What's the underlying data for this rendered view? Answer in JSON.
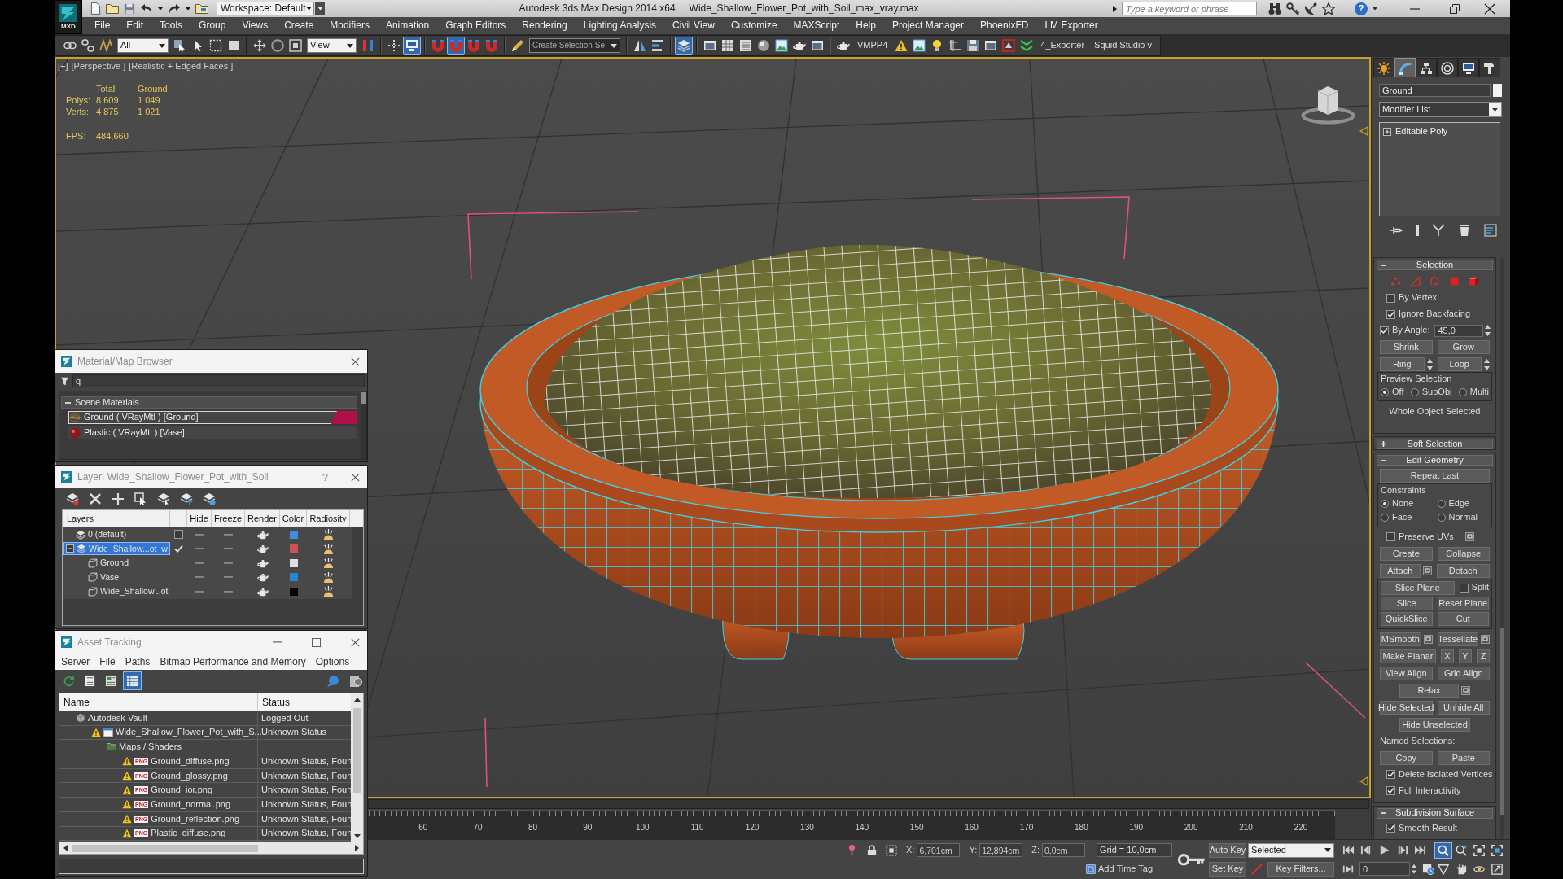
{
  "app": {
    "logo": "MXD",
    "workspace": "Workspace: Default",
    "title": "Autodesk 3ds Max Design 2014 x64",
    "document": "Wide_Shallow_Flower_Pot_with_Soil_max_vray.max",
    "search": {
      "placeholder": "Type a keyword or phrase"
    },
    "help": "?"
  },
  "menu": [
    "File",
    "Edit",
    "Tools",
    "Group",
    "Views",
    "Create",
    "Modifiers",
    "Animation",
    "Graph Editors",
    "Rendering",
    "Lighting Analysis",
    "Civil View",
    "Customize",
    "MAXScript",
    "Help",
    "Project Manager",
    "PhoenixFD",
    "LM Exporter"
  ],
  "toolbar": [
    {
      "kind": "button",
      "on": false
    },
    {
      "kind": "button",
      "on": false
    },
    {
      "kind": "button",
      "on": false
    },
    {
      "kind": "dropdown",
      "value": "All"
    },
    {
      "kind": "button",
      "on": false
    },
    {
      "kind": "button",
      "on": false
    },
    {
      "kind": "button",
      "on": false
    },
    {
      "kind": "button",
      "on": false
    },
    {
      "kind": "separator"
    },
    {
      "kind": "button",
      "on": false
    },
    {
      "kind": "button",
      "on": false
    },
    {
      "kind": "button",
      "on": false
    },
    {
      "kind": "dropdown",
      "value": "View"
    },
    {
      "kind": "button",
      "on": false
    },
    {
      "kind": "separator"
    },
    {
      "kind": "button",
      "on": false
    },
    {
      "kind": "button",
      "on": true
    },
    {
      "kind": "separator"
    },
    {
      "kind": "button",
      "on": false
    },
    {
      "kind": "button",
      "on": true
    },
    {
      "kind": "button",
      "on": false
    },
    {
      "kind": "button",
      "on": false
    },
    {
      "kind": "separator"
    },
    {
      "kind": "button",
      "on": false
    },
    {
      "kind": "combo",
      "value": "Create Selection Se"
    },
    {
      "kind": "separator"
    },
    {
      "kind": "button",
      "on": false
    },
    {
      "kind": "button",
      "on": false
    },
    {
      "kind": "separator"
    },
    {
      "kind": "button",
      "on": true
    },
    {
      "kind": "separator"
    },
    {
      "kind": "button",
      "on": false
    },
    {
      "kind": "button",
      "on": false
    },
    {
      "kind": "button",
      "on": false
    },
    {
      "kind": "button",
      "on": false
    },
    {
      "kind": "button",
      "on": false
    },
    {
      "kind": "button",
      "on": false
    },
    {
      "kind": "button",
      "on": false
    },
    {
      "kind": "separator"
    },
    {
      "kind": "button",
      "on": false
    },
    {
      "kind": "label",
      "text": "VMPP4"
    },
    {
      "kind": "button",
      "on": false
    },
    {
      "kind": "button",
      "on": false
    },
    {
      "kind": "button",
      "on": false
    },
    {
      "kind": "button",
      "on": false
    },
    {
      "kind": "button",
      "on": false
    },
    {
      "kind": "button",
      "on": false
    },
    {
      "kind": "button",
      "on": false
    },
    {
      "kind": "button",
      "on": false
    },
    {
      "kind": "label",
      "text": "4_Exporter"
    },
    {
      "kind": "label",
      "text": "Squid Studio v"
    }
  ],
  "viewport": {
    "labels": [
      "[+]",
      "[Perspective ]",
      "[Realistic + Edged Faces ]"
    ],
    "stats": {
      "columns": [
        "Total",
        "Ground"
      ],
      "rows": [
        {
          "label": "Polys:",
          "values": [
            "8 609",
            "1 049"
          ]
        },
        {
          "label": "Verts:",
          "values": [
            "4 875",
            "1 021"
          ]
        }
      ]
    },
    "fps": {
      "label": "FPS:",
      "value": "484,660"
    }
  },
  "material_browser": {
    "title": "Material/Map Browser",
    "search": "q",
    "section": {
      "label": "Scene Materials",
      "expanded": true
    },
    "items": [
      {
        "label": "Ground ( VRayMtl ) [Ground]",
        "selected": true
      },
      {
        "label": "Plastic ( VRayMtl ) [Vase]",
        "selected": false
      }
    ]
  },
  "layer_window": {
    "title": "Layer: Wide_Shallow_Flower_Pot_with_Soil",
    "help": "?",
    "columns": [
      "Layers",
      "Hide",
      "Freeze",
      "Render",
      "Color",
      "Radiosity"
    ],
    "layers": [
      {
        "kind": "layer",
        "name": "0 (default)",
        "current": false,
        "selected": false,
        "hidden": false,
        "frozen": false,
        "renderable": true,
        "color": "#3f8fdc"
      },
      {
        "kind": "layer",
        "name": "Wide_Shallow...ot_w",
        "current": true,
        "selected": true,
        "expanded": true,
        "hidden": false,
        "frozen": false,
        "renderable": true,
        "color": "#cc5252",
        "children": [
          {
            "kind": "object",
            "name": "Ground",
            "selected": false,
            "hidden": false,
            "frozen": false,
            "renderable": true,
            "color": "#dedede"
          },
          {
            "kind": "object",
            "name": "Vase",
            "selected": false,
            "hidden": false,
            "frozen": false,
            "renderable": true,
            "color": "#2388d2"
          },
          {
            "kind": "object",
            "name": "Wide_Shallow...ot",
            "selected": false,
            "hidden": false,
            "frozen": false,
            "renderable": true,
            "color": "#050505"
          }
        ]
      }
    ]
  },
  "asset_tracking": {
    "title": "Asset Tracking",
    "menu": [
      "Server",
      "File",
      "Paths",
      "Bitmap Performance and Memory",
      "Options"
    ],
    "tools": [
      {
        "on": false
      },
      {
        "on": false
      },
      {
        "on": false
      },
      {
        "on": true
      }
    ],
    "columns": [
      "Name",
      "Status"
    ],
    "rows": [
      {
        "kind": "vault",
        "name": "Autodesk Vault",
        "status": "Logged Out",
        "children": [
          {
            "kind": "scene",
            "name": "Wide_Shallow_Flower_Pot_with_S...",
            "status": "Unknown Status",
            "children": [
              {
                "kind": "folder",
                "name": "Maps / Shaders",
                "children": [
                  {
                    "kind": "file",
                    "badge": "PNG",
                    "name": "Ground_diffuse.png",
                    "status": "Unknown Status, Foun"
                  },
                  {
                    "kind": "file",
                    "badge": "PNG",
                    "name": "Ground_glossy.png",
                    "status": "Unknown Status, Foun"
                  },
                  {
                    "kind": "file",
                    "badge": "PNG",
                    "name": "Ground_ior.png",
                    "status": "Unknown Status, Foun"
                  },
                  {
                    "kind": "file",
                    "badge": "PNG",
                    "name": "Ground_normal.png",
                    "status": "Unknown Status, Foun"
                  },
                  {
                    "kind": "file",
                    "badge": "PNG",
                    "name": "Ground_reflection.png",
                    "status": "Unknown Status, Foun"
                  },
                  {
                    "kind": "file",
                    "badge": "PNG",
                    "name": "Plastic_diffuse.png",
                    "status": "Unknown Status, Foun"
                  }
                ]
              }
            ]
          }
        ]
      }
    ]
  },
  "command_panel": {
    "tabs": [
      {
        "selected": false
      },
      {
        "selected": true
      },
      {
        "selected": false
      },
      {
        "selected": false
      },
      {
        "selected": false
      },
      {
        "selected": false
      }
    ],
    "object": {
      "name": "Ground",
      "color": "#f2f2f2"
    },
    "modifier_list": "Modifier List",
    "stack": [
      {
        "label": "Editable Poly",
        "expanded": false
      }
    ],
    "rollouts": [
      {
        "title": "Selection",
        "expanded": true,
        "rows": [
          {
            "items": [
              {
                "kind": "subobject",
                "selected": false
              },
              {
                "kind": "subobject",
                "selected": false
              },
              {
                "kind": "subobject",
                "selected": false
              },
              {
                "kind": "subobject",
                "selected": false
              },
              {
                "kind": "subobject",
                "selected": false
              }
            ]
          },
          {
            "items": [
              {
                "kind": "check",
                "label": "By Vertex",
                "checked": false
              }
            ]
          },
          {
            "items": [
              {
                "kind": "check",
                "label": "Ignore Backfacing",
                "checked": true
              }
            ]
          },
          {
            "items": [
              {
                "kind": "check",
                "label": "By Angle:",
                "checked": true
              },
              {
                "kind": "spinner",
                "value": "45,0"
              }
            ]
          },
          {
            "items": [
              {
                "kind": "button",
                "label": "Shrink"
              },
              {
                "kind": "button",
                "label": "Grow"
              }
            ]
          },
          {
            "items": [
              {
                "kind": "button",
                "label": "Ring",
                "spinner": true
              },
              {
                "kind": "button",
                "label": "Loop",
                "spinner": true
              }
            ]
          },
          {
            "kind": "group",
            "label": "Preview Selection",
            "rows": [
              {
                "items": [
                  {
                    "kind": "radio",
                    "label": "Off",
                    "selected": true
                  },
                  {
                    "kind": "radio",
                    "label": "SubObj",
                    "selected": false
                  },
                  {
                    "kind": "radio",
                    "label": "Multi",
                    "selected": false
                  }
                ]
              }
            ]
          },
          {
            "items": [
              {
                "kind": "status",
                "text": "Whole Object Selected"
              }
            ]
          }
        ]
      },
      {
        "title": "Soft Selection",
        "expanded": false
      },
      {
        "title": "Edit Geometry",
        "expanded": true,
        "rows": [
          {
            "items": [
              {
                "kind": "button",
                "label": "Repeat Last"
              }
            ]
          },
          {
            "kind": "group",
            "label": "Constraints",
            "rows": [
              {
                "items": [
                  {
                    "kind": "radio",
                    "label": "None",
                    "selected": true
                  },
                  {
                    "kind": "radio",
                    "label": "Edge",
                    "selected": false
                  }
                ]
              },
              {
                "items": [
                  {
                    "kind": "radio",
                    "label": "Face",
                    "selected": false
                  },
                  {
                    "kind": "radio",
                    "label": "Normal",
                    "selected": false
                  }
                ]
              }
            ]
          },
          {
            "items": [
              {
                "kind": "check",
                "label": "Preserve UVs",
                "checked": false,
                "settings": true
              }
            ]
          },
          {
            "items": [
              {
                "kind": "button",
                "label": "Create"
              },
              {
                "kind": "button",
                "label": "Collapse"
              }
            ]
          },
          {
            "items": [
              {
                "kind": "button",
                "label": "Attach",
                "settings": true
              },
              {
                "kind": "button",
                "label": "Detach"
              }
            ]
          },
          {
            "kind": "group",
            "rows": [
              {
                "items": [
                  {
                    "kind": "button",
                    "label": "Slice Plane"
                  },
                  {
                    "kind": "check",
                    "label": "Split",
                    "checked": false
                  }
                ]
              },
              {
                "items": [
                  {
                    "kind": "button",
                    "label": "Slice"
                  },
                  {
                    "kind": "button",
                    "label": "Reset Plane"
                  }
                ]
              },
              {
                "items": [
                  {
                    "kind": "button",
                    "label": "QuickSlice"
                  },
                  {
                    "kind": "button",
                    "label": "Cut"
                  }
                ]
              }
            ]
          },
          {
            "items": [
              {
                "kind": "button",
                "label": "MSmooth",
                "settings": true
              },
              {
                "kind": "button",
                "label": "Tessellate",
                "settings": true
              }
            ]
          },
          {
            "items": [
              {
                "kind": "button",
                "label": "Make Planar"
              },
              {
                "kind": "axis",
                "label": "X"
              },
              {
                "kind": "axis",
                "label": "Y"
              },
              {
                "kind": "axis",
                "label": "Z"
              }
            ]
          },
          {
            "items": [
              {
                "kind": "button",
                "label": "View Align"
              },
              {
                "kind": "button",
                "label": "Grid Align"
              }
            ]
          },
          {
            "items": [
              {
                "kind": "button",
                "label": "Relax",
                "settings": true
              }
            ]
          },
          {
            "items": [
              {
                "kind": "button",
                "label": "Hide Selected"
              },
              {
                "kind": "button",
                "label": "Unhide All"
              }
            ]
          },
          {
            "items": [
              {
                "kind": "button",
                "label": "Hide Unselected"
              }
            ]
          },
          {
            "items": [
              {
                "kind": "label",
                "text": "Named Selections:"
              }
            ]
          },
          {
            "items": [
              {
                "kind": "button",
                "label": "Copy"
              },
              {
                "kind": "button",
                "label": "Paste"
              }
            ]
          },
          {
            "items": [
              {
                "kind": "check",
                "label": "Delete Isolated Vertices",
                "checked": true
              }
            ]
          },
          {
            "items": [
              {
                "kind": "check",
                "label": "Full Interactivity",
                "checked": true
              }
            ]
          }
        ]
      },
      {
        "title": "Subdivision Surface",
        "expanded": true,
        "rows": [
          {
            "items": [
              {
                "kind": "check",
                "label": "Smooth Result",
                "checked": true
              }
            ]
          }
        ]
      }
    ]
  },
  "timeline": {
    "ticks": [
      "60",
      "70",
      "80",
      "90",
      "100",
      "110",
      "120",
      "130",
      "140",
      "150",
      "160",
      "170",
      "180",
      "190",
      "200",
      "210",
      "220"
    ]
  },
  "status_bar": {
    "coords": [
      {
        "axis": "X:",
        "value": "6,701cm"
      },
      {
        "axis": "Y:",
        "value": "12,894cm"
      },
      {
        "axis": "Z:",
        "value": "0,0cm"
      }
    ],
    "grid": "Grid = 10,0cm",
    "time_tag": "Add Time Tag",
    "auto_key": {
      "label": "Auto Key",
      "on": false
    },
    "key_mode": "Selected",
    "set_key": "Set Key",
    "key_filters": "Key Filters...",
    "frame": "0",
    "viewport_tools": [
      {
        "on": true
      },
      {
        "on": false
      },
      {
        "on": false
      },
      {
        "on": false
      },
      {
        "on": false
      },
      {
        "on": false
      },
      {
        "on": false
      },
      {
        "on": false
      }
    ]
  }
}
